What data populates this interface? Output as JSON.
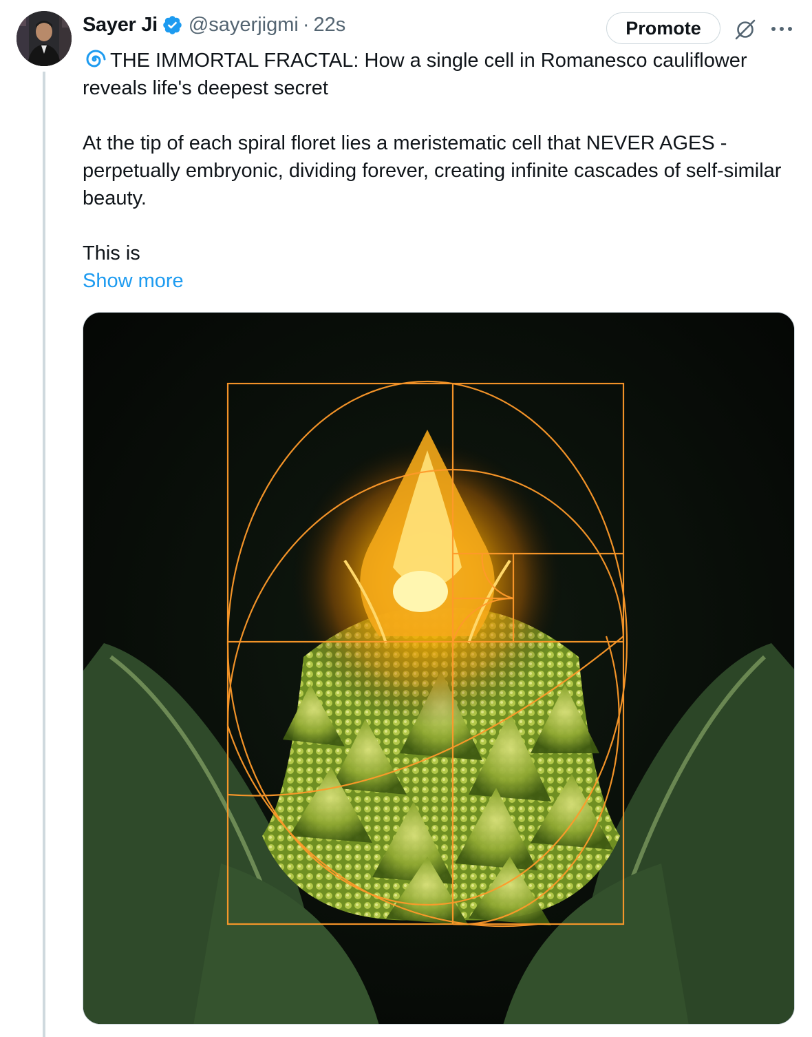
{
  "author": {
    "display_name": "Sayer Ji",
    "handle": "@sayerjigmi",
    "separator": "·",
    "time": "22s",
    "verified": true
  },
  "actions": {
    "promote_label": "Promote",
    "grok_icon": "grok-icon",
    "more_icon": "more-icon"
  },
  "tweet": {
    "emoji": "spiral-emoji",
    "line1": "THE IMMORTAL FRACTAL: How a single cell in Romanesco cauliflower reveals life's deepest secret",
    "paragraph2": "At the tip of each spiral floret lies a meristematic cell that NEVER AGES - perpetually embryonic, dividing forever, creating infinite cascades of self-similar beauty.",
    "paragraph3": "This is",
    "show_more": "Show more"
  },
  "colors": {
    "link": "#1d9bf0",
    "verified": "#1d9bf0",
    "muted": "#536471",
    "text": "#0f1419",
    "border": "#cfd9de",
    "golden_glow": "#ffb347"
  },
  "media": {
    "kind": "image",
    "subject": "romanesco-golden-spiral-image"
  }
}
